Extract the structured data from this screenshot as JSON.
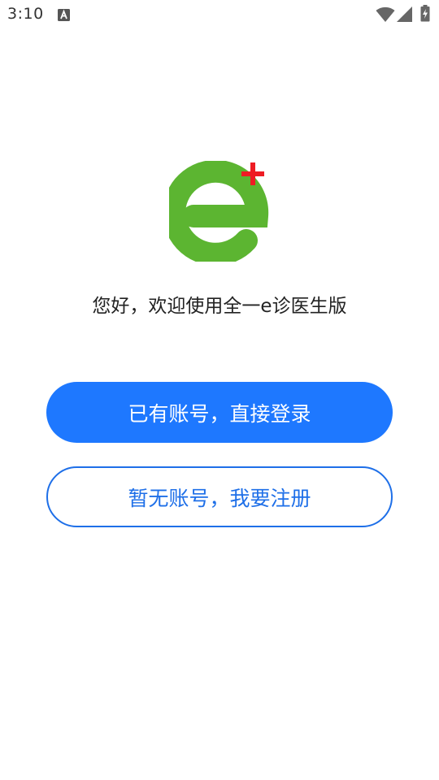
{
  "status_bar": {
    "time": "3:10",
    "notification_icon": "font-a-icon",
    "wifi_icon": "wifi-icon",
    "signal_icon": "cell-signal-icon",
    "battery_icon": "battery-charging-icon"
  },
  "app": {
    "logo": "app-logo-e-plus",
    "welcome_text": "您好，欢迎使用全一e诊医生版"
  },
  "actions": {
    "login_label": "已有账号，直接登录",
    "register_label": "暂无账号，我要注册"
  },
  "colors": {
    "primary_blue": "#1e78ff",
    "logo_green": "#5cb531",
    "logo_red": "#ee1c24"
  }
}
